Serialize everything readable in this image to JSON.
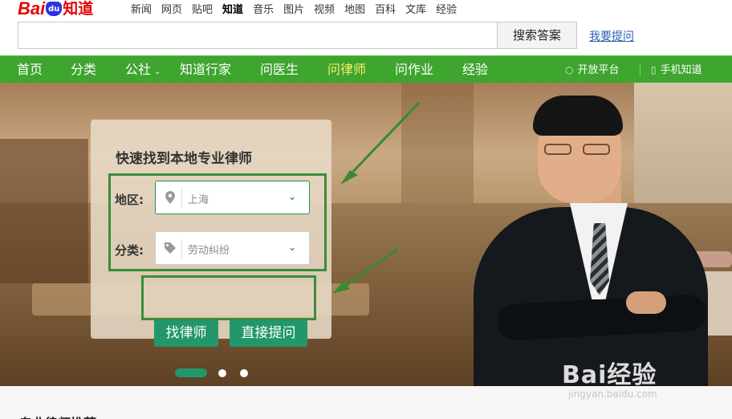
{
  "brand": {
    "logo_bai": "Bai",
    "logo_du": "du",
    "logo_zhidao": "知道"
  },
  "topnav": [
    "新闻",
    "网页",
    "贴吧",
    "知道",
    "音乐",
    "图片",
    "视频",
    "地图",
    "百科",
    "文库",
    "经验"
  ],
  "search": {
    "value": "",
    "button_label": "搜索答案",
    "ask_link": "我要提问"
  },
  "mainnav": {
    "items": [
      "首页",
      "分类",
      "公社",
      "知道行家",
      "问医生",
      "问律师",
      "问作业",
      "经验"
    ],
    "current_index": 5,
    "right": [
      "开放平台",
      "手机知道"
    ]
  },
  "lawyer_panel": {
    "title": "快速找到本地专业律师",
    "region_label": "地区:",
    "region_value": "上海",
    "category_label": "分类:",
    "category_value": "劳动纠纷",
    "find_button": "找律师",
    "ask_button": "直接提问"
  },
  "carousel": {
    "slides": 3,
    "active": 0
  },
  "watermark": {
    "brand": "Bai经验",
    "url": "jingyan.baidu.com"
  },
  "section": {
    "title": "专业律师推荐"
  },
  "colors": {
    "nav_green": "#3ea52f",
    "button_green": "#22986a",
    "highlight": "#3a8d3a",
    "logo_red": "#e10601",
    "link_blue": "#2b5fb3"
  }
}
